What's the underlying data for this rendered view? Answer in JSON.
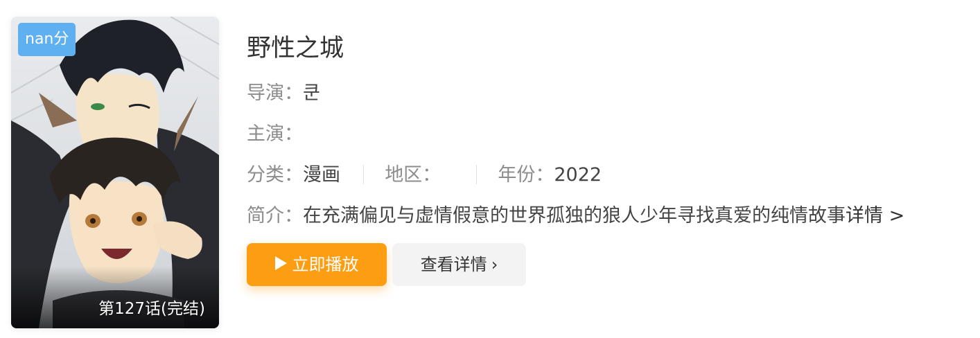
{
  "poster": {
    "score_badge": "nan分",
    "episode_label": "第127话(完结)",
    "art_description": "manga-cover-illustration"
  },
  "title": "野性之城",
  "director": {
    "label": "导演：",
    "value": "쿤"
  },
  "cast": {
    "label": "主演：",
    "value": ""
  },
  "meta": {
    "category_label": "分类：",
    "category_value": "漫画",
    "region_label": "地区：",
    "region_value": "",
    "year_label": "年份：",
    "year_value": "2022"
  },
  "synopsis": {
    "label": "简介：",
    "text": "在充满偏见与虚情假意的世界孤独的狼人少年寻找真爱的纯情故事",
    "more_link": "详情 >"
  },
  "buttons": {
    "play_label": "立即播放",
    "detail_label": "查看详情",
    "detail_chevron": "›"
  },
  "colors": {
    "accent": "#fd9d12",
    "badge": "#5fb0f0",
    "secondary_button": "#f3f3f3",
    "label_gray": "#8c8c8c"
  },
  "icons": {
    "play": "play-triangle-icon",
    "detail": "chevron-right-icon"
  }
}
